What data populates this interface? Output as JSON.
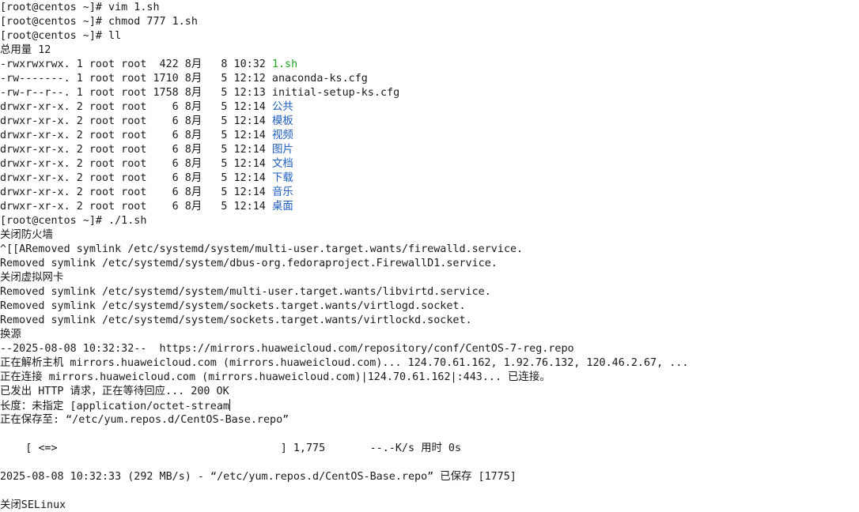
{
  "terminal": {
    "lines": [
      [
        {
          "text": "[root@centos ~]# vim 1.sh"
        }
      ],
      [
        {
          "text": "[root@centos ~]# chmod 777 1.sh"
        }
      ],
      [
        {
          "text": "[root@centos ~]# ll"
        }
      ],
      [
        {
          "text": "总用量 12"
        }
      ],
      [
        {
          "text": "-rwxrwxrwx. 1 root root  422 8月   8 10:32 "
        },
        {
          "text": "1.sh",
          "color": "green"
        }
      ],
      [
        {
          "text": "-rw-------. 1 root root 1710 8月   5 12:12 anaconda-ks.cfg"
        }
      ],
      [
        {
          "text": "-rw-r--r--. 1 root root 1758 8月   5 12:13 initial-setup-ks.cfg"
        }
      ],
      [
        {
          "text": "drwxr-xr-x. 2 root root    6 8月   5 12:14 "
        },
        {
          "text": "公共",
          "color": "blue"
        }
      ],
      [
        {
          "text": "drwxr-xr-x. 2 root root    6 8月   5 12:14 "
        },
        {
          "text": "模板",
          "color": "blue"
        }
      ],
      [
        {
          "text": "drwxr-xr-x. 2 root root    6 8月   5 12:14 "
        },
        {
          "text": "视频",
          "color": "blue"
        }
      ],
      [
        {
          "text": "drwxr-xr-x. 2 root root    6 8月   5 12:14 "
        },
        {
          "text": "图片",
          "color": "blue"
        }
      ],
      [
        {
          "text": "drwxr-xr-x. 2 root root    6 8月   5 12:14 "
        },
        {
          "text": "文档",
          "color": "blue"
        }
      ],
      [
        {
          "text": "drwxr-xr-x. 2 root root    6 8月   5 12:14 "
        },
        {
          "text": "下载",
          "color": "blue"
        }
      ],
      [
        {
          "text": "drwxr-xr-x. 2 root root    6 8月   5 12:14 "
        },
        {
          "text": "音乐",
          "color": "blue"
        }
      ],
      [
        {
          "text": "drwxr-xr-x. 2 root root    6 8月   5 12:14 "
        },
        {
          "text": "桌面",
          "color": "blue"
        }
      ],
      [
        {
          "text": "[root@centos ~]# ./1.sh"
        }
      ],
      [
        {
          "text": "关闭防火墙"
        }
      ],
      [
        {
          "text": "^[[ARemoved symlink /etc/systemd/system/multi-user.target.wants/firewalld.service."
        }
      ],
      [
        {
          "text": "Removed symlink /etc/systemd/system/dbus-org.fedoraproject.FirewallD1.service."
        }
      ],
      [
        {
          "text": "关闭虚拟网卡"
        }
      ],
      [
        {
          "text": "Removed symlink /etc/systemd/system/multi-user.target.wants/libvirtd.service."
        }
      ],
      [
        {
          "text": "Removed symlink /etc/systemd/system/sockets.target.wants/virtlogd.socket."
        }
      ],
      [
        {
          "text": "Removed symlink /etc/systemd/system/sockets.target.wants/virtlockd.socket."
        }
      ],
      [
        {
          "text": "换源"
        }
      ],
      [
        {
          "text": "--2025-08-08 10:32:32--  https://mirrors.huaweicloud.com/repository/conf/CentOS-7-reg.repo"
        }
      ],
      [
        {
          "text": "正在解析主机 mirrors.huaweicloud.com (mirrors.huaweicloud.com)... 124.70.61.162, 1.92.76.132, 120.46.2.67, ..."
        }
      ],
      [
        {
          "text": "正在连接 mirrors.huaweicloud.com (mirrors.huaweicloud.com)|124.70.61.162|:443... 已连接。"
        }
      ],
      [
        {
          "text": "已发出 HTTP 请求，正在等待回应... 200 OK"
        }
      ],
      [
        {
          "text": "长度：未指定 [application/octet-stream"
        },
        {
          "cursor": true
        }
      ],
      [
        {
          "text": "正在保存至: “/etc/yum.repos.d/CentOS-Base.repo”"
        }
      ],
      [
        {
          "text": ""
        }
      ],
      [
        {
          "text": "    [ <=>                                   ] 1,775       --.-K/s 用时 0s"
        }
      ],
      [
        {
          "text": ""
        }
      ],
      [
        {
          "text": "2025-08-08 10:32:33 (292 MB/s) - “/etc/yum.repos.d/CentOS-Base.repo” 已保存 [1775]"
        }
      ],
      [
        {
          "text": ""
        }
      ],
      [
        {
          "text": "关闭SELinux"
        }
      ]
    ]
  },
  "colors": {
    "background": "#ffffff",
    "foreground": "#1a1a1a",
    "blue": "#1f5fbf",
    "green": "#1fa31f"
  }
}
